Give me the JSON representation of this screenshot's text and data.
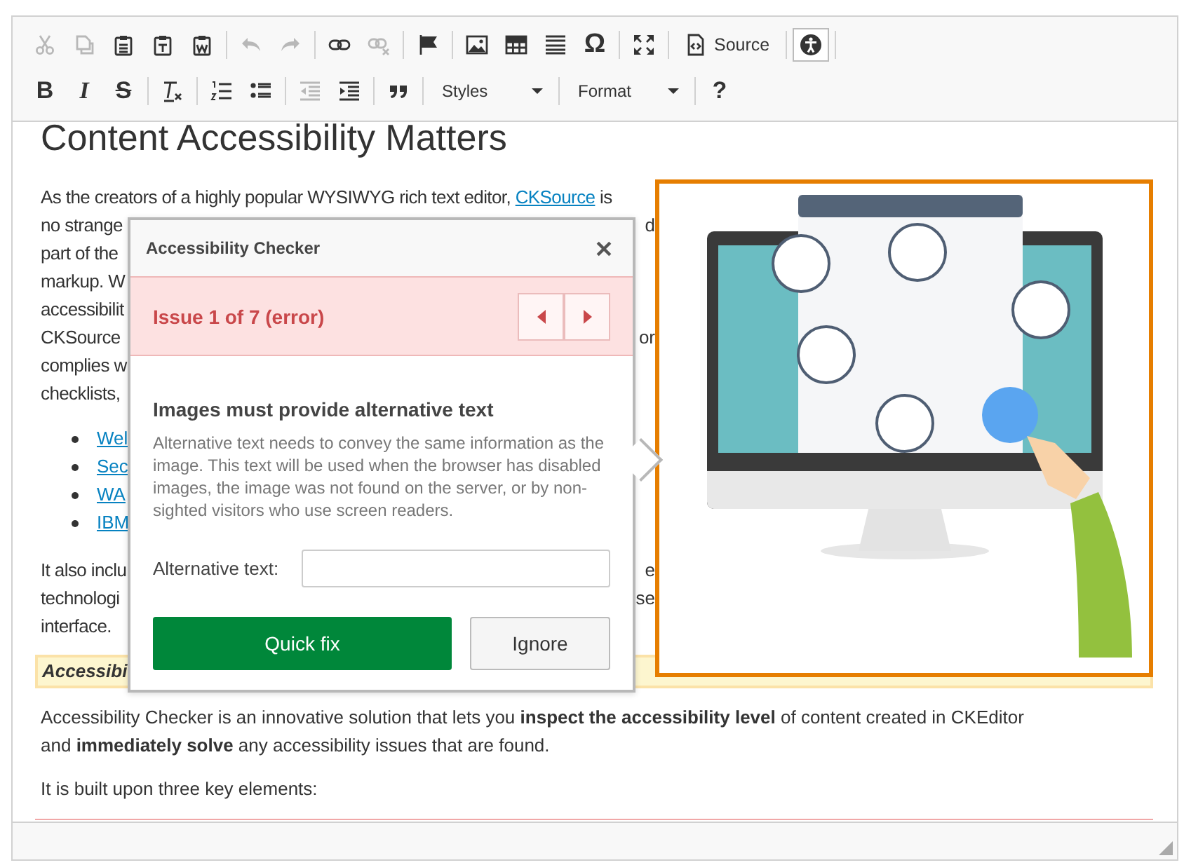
{
  "toolbar": {
    "rows": [
      {
        "items": [
          {
            "kind": "icon",
            "disabled": true,
            "pressed": false
          },
          {
            "kind": "icon",
            "disabled": true,
            "pressed": false
          },
          {
            "kind": "icon",
            "disabled": false,
            "pressed": false
          },
          {
            "kind": "icon",
            "disabled": false,
            "pressed": false
          },
          {
            "kind": "icon",
            "disabled": false,
            "pressed": false
          },
          {
            "kind": "separator"
          },
          {
            "kind": "icon",
            "disabled": true,
            "pressed": false
          },
          {
            "kind": "icon",
            "disabled": true,
            "pressed": false
          },
          {
            "kind": "separator"
          },
          {
            "kind": "icon",
            "disabled": false,
            "pressed": false
          },
          {
            "kind": "icon",
            "disabled": true,
            "pressed": false
          },
          {
            "kind": "separator"
          },
          {
            "kind": "icon",
            "disabled": false,
            "pressed": false
          },
          {
            "kind": "separator"
          },
          {
            "kind": "icon",
            "disabled": false,
            "pressed": false
          },
          {
            "kind": "icon",
            "disabled": false,
            "pressed": false
          },
          {
            "kind": "icon",
            "disabled": false,
            "pressed": false
          },
          {
            "kind": "glyph",
            "text": "Ω",
            "disabled": false,
            "pressed": false
          },
          {
            "kind": "separator"
          },
          {
            "kind": "icon",
            "disabled": false,
            "pressed": false
          },
          {
            "kind": "separator"
          },
          {
            "kind": "label",
            "text": "Source",
            "disabled": false,
            "pressed": false
          },
          {
            "kind": "separator"
          },
          {
            "kind": "icon",
            "disabled": false,
            "pressed": true
          },
          {
            "kind": "separator"
          }
        ]
      },
      {
        "items": [
          {
            "kind": "glyph",
            "text": "B",
            "disabled": false,
            "pressed": false
          },
          {
            "kind": "glyph",
            "text": "I",
            "disabled": false,
            "pressed": false
          },
          {
            "kind": "glyph",
            "text": "S",
            "disabled": false,
            "pressed": false
          },
          {
            "kind": "separator"
          },
          {
            "kind": "icon",
            "disabled": false,
            "pressed": false
          },
          {
            "kind": "separator"
          },
          {
            "kind": "icon",
            "disabled": false,
            "pressed": false
          },
          {
            "kind": "icon",
            "disabled": false,
            "pressed": false
          },
          {
            "kind": "separator"
          },
          {
            "kind": "icon",
            "disabled": true,
            "pressed": false
          },
          {
            "kind": "icon",
            "disabled": false,
            "pressed": false
          },
          {
            "kind": "separator"
          },
          {
            "kind": "icon",
            "disabled": false,
            "pressed": false
          },
          {
            "kind": "separator"
          },
          {
            "kind": "dropdown",
            "text": "Styles",
            "disabled": false,
            "pressed": false
          },
          {
            "kind": "separator"
          },
          {
            "kind": "dropdown",
            "text": "Format",
            "disabled": false,
            "pressed": false
          },
          {
            "kind": "separator"
          },
          {
            "kind": "glyph",
            "text": "?",
            "disabled": false,
            "pressed": false
          }
        ]
      }
    ]
  },
  "editor": {
    "heading": "Content Accessibility Matters",
    "intro": [
      {
        "text": "As the creators of a highly popular WYSIWYG rich text editor,",
        "link": "CKSource",
        "after": "is"
      },
      {
        "text": "no strange",
        "tail": "d"
      },
      {
        "text": "part of the"
      },
      {
        "text": "markup. W"
      },
      {
        "text": "accessibilit"
      },
      {
        "text": "CKSource",
        "tail": "or"
      },
      {
        "text": "complies w"
      },
      {
        "text": "checklists,"
      }
    ],
    "list": [
      "Wel",
      "Sec",
      "WA",
      "IBM"
    ],
    "para2": [
      {
        "text": "It also inclu",
        "tail": "e"
      },
      {
        "text": "technologi",
        "tail": "se"
      },
      {
        "text": "interface."
      }
    ],
    "highlight": "Accessibi",
    "para3": "Accessibility Checker is an innovative solution that lets you **inspect the accessibility level** of content created in CKEditor and **immediately solve** any accessibility issues that are found.",
    "para4": "It is built upon three key elements:"
  },
  "dialog": {
    "title": "Accessibility Checker",
    "issue": "Issue 1 of 7 (error)",
    "heading": "Images must provide alternative text",
    "description": "Alternative text needs to convey the same information as the image. This text will be used when the browser has disabled images, the image was not found on the server, or by non-sighted visitors who use screen readers.",
    "field_label": "Alternative text:",
    "buttons": [
      "Quick fix",
      "Ignore"
    ]
  }
}
